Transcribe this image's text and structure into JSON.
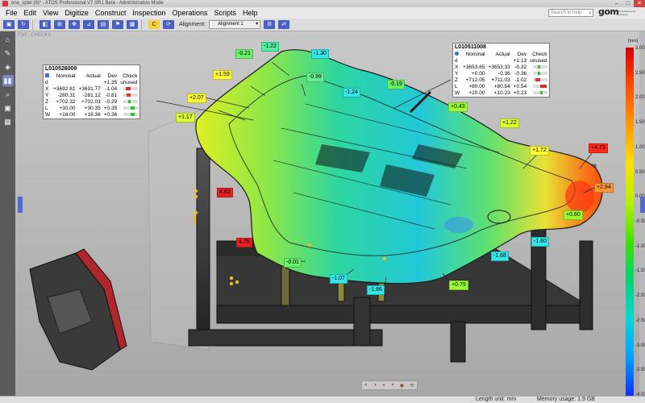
{
  "window": {
    "title": "one_spiel (9)* - ATOS Professional V7 SR1 Beta - Administration Mode",
    "minimize": "–",
    "maximize": "□",
    "close": "✕"
  },
  "menu": [
    "File",
    "Edit",
    "View",
    "Digitize",
    "Construct",
    "Inspection",
    "Operations",
    "Scripts",
    "Help"
  ],
  "search": {
    "placeholder": "Search in help",
    "icon": "⌕"
  },
  "logo": {
    "mark": "gom",
    "tagline": "Optical Measuring Techniques"
  },
  "toolbar": {
    "alignment_label": "Alignment:",
    "alignment_value": "Alignment 1",
    "dropdown_icon": "▾",
    "yellow_icon": "C"
  },
  "breadcrumb": "F3P · CHECKS",
  "tables": [
    {
      "name": "L010526009",
      "headers": [
        "",
        "Nominal",
        "Actual",
        "Dev",
        "Check"
      ],
      "rows": [
        {
          "axis": "d",
          "nominal": "",
          "actual": "",
          "dev": "+1.35",
          "check": "unused"
        },
        {
          "axis": "X",
          "nominal": "+3692.81",
          "actual": "+3691.77",
          "dev": "-1.04"
        },
        {
          "axis": "Y",
          "nominal": "-280.31",
          "actual": "-281.12",
          "dev": "-0.81"
        },
        {
          "axis": "Z",
          "nominal": "+702.32",
          "actual": "+702.03",
          "dev": "-0.29"
        },
        {
          "axis": "L",
          "nominal": "+30.00",
          "actual": "+30.35",
          "dev": "+0.35"
        },
        {
          "axis": "W",
          "nominal": "+16.00",
          "actual": "+16.36",
          "dev": "+0.36"
        }
      ]
    },
    {
      "name": "L010511008",
      "headers": [
        "",
        "Nominal",
        "Actual",
        "Dev",
        "Check"
      ],
      "rows": [
        {
          "axis": "d",
          "nominal": "",
          "actual": "",
          "dev": "+1.13",
          "check": "unused"
        },
        {
          "axis": "X",
          "nominal": "+3653.65",
          "actual": "+3653.33",
          "dev": "-0.32"
        },
        {
          "axis": "Y",
          "nominal": "+0.00",
          "actual": "-0.36",
          "dev": "-0.36"
        },
        {
          "axis": "Z",
          "nominal": "+712.05",
          "actual": "+711.03",
          "dev": "-1.02"
        },
        {
          "axis": "L",
          "nominal": "+80.00",
          "actual": "+80.54",
          "dev": "+0.54"
        },
        {
          "axis": "W",
          "nominal": "+10.00",
          "actual": "+10.23",
          "dev": "+0.23"
        }
      ]
    }
  ],
  "deviation_labels": [
    {
      "text": "-1.22",
      "color": "#4ef0a0"
    },
    {
      "text": "-0.21",
      "color": "#6ef070"
    },
    {
      "text": "-1.30",
      "color": "#35e6e6"
    },
    {
      "text": "+1.59",
      "color": "#ffff33"
    },
    {
      "text": "-0.99",
      "color": "#66f090"
    },
    {
      "text": "-0.19",
      "color": "#66f066"
    },
    {
      "text": "-1.24",
      "color": "#35e6e6"
    },
    {
      "text": "+2.07",
      "color": "#ffff33"
    },
    {
      "text": "+0.43",
      "color": "#99ff33"
    },
    {
      "text": "+1.17",
      "color": "#ddff33"
    },
    {
      "text": "+1.22",
      "color": "#ddff33"
    },
    {
      "text": "+1.72",
      "color": "#ffff33"
    },
    {
      "text": "+4.73",
      "color": "#ff2a1a"
    },
    {
      "text": "+2.94",
      "color": "#ff9933"
    },
    {
      "text": "+0.80",
      "color": "#99ff33"
    },
    {
      "text": "-1.60",
      "color": "#35e6e6"
    },
    {
      "text": "-1.68",
      "color": "#35e6e6"
    },
    {
      "text": "-0.01",
      "color": "#66f066"
    },
    {
      "text": "-1.07",
      "color": "#35e6e6"
    },
    {
      "text": "-1.86",
      "color": "#35e6e6"
    },
    {
      "text": "+0.79",
      "color": "#99ff33"
    },
    {
      "text": "4.82",
      "color": "#e82020"
    },
    {
      "text": "4.75",
      "color": "#e82020"
    }
  ],
  "scale": {
    "unit": "[mm]",
    "ticks": [
      "3.00",
      "2.50",
      "2.00",
      "1.50",
      "1.00",
      "0.50",
      "0.00",
      "-0.50",
      "-1.00",
      "-1.50",
      "-2.00",
      "-2.50",
      "-3.00",
      "-3.50",
      "-4.00"
    ]
  },
  "status": {
    "length_unit": "Length unit: mm",
    "memory": "Memory usage: 1.9 GB"
  }
}
